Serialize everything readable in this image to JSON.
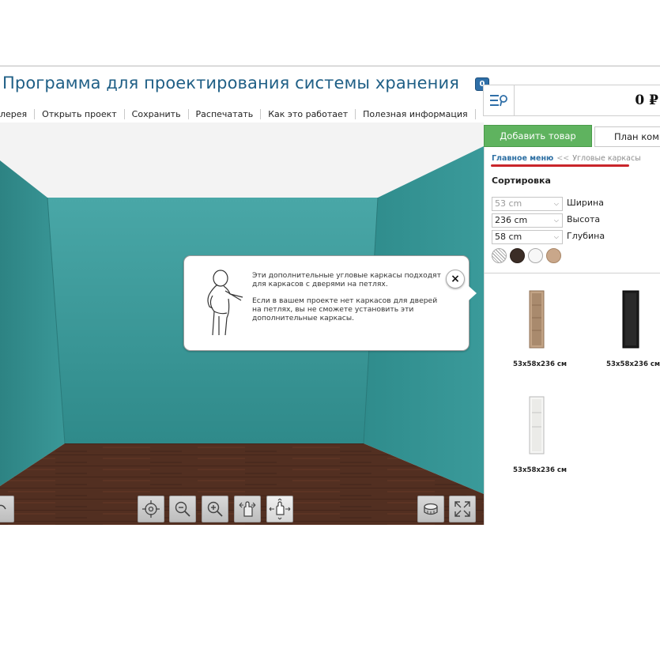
{
  "header": {
    "title": "Программа для проектирования системы хранения"
  },
  "menu": {
    "items": [
      {
        "label": "лерея"
      },
      {
        "label": "Открыть проект"
      },
      {
        "label": "Сохранить"
      },
      {
        "label": "Распечатать"
      },
      {
        "label": "Как это работает"
      },
      {
        "label": "Полезная информация"
      }
    ]
  },
  "cart": {
    "count": "0",
    "icon": "cart-list-icon",
    "price": "0 ₽"
  },
  "tabs": {
    "add_product": "Добавить товар",
    "room_plan": "План комн"
  },
  "breadcrumb": {
    "main": "Главное меню",
    "separator": "<<",
    "current": "Угловые каркасы"
  },
  "sorting": {
    "title": "Сортировка",
    "width": {
      "value": "53 cm",
      "label": "Ширина",
      "disabled": true
    },
    "height": {
      "value": "236 cm",
      "label": "Высота"
    },
    "depth": {
      "value": "58 cm",
      "label": "Глубина"
    }
  },
  "color_swatches": [
    {
      "name": "striped-pattern",
      "color": "#d0d0d0"
    },
    {
      "name": "dark-brown",
      "color": "#3b2d26"
    },
    {
      "name": "white",
      "color": "#f7f7f7"
    },
    {
      "name": "oak",
      "color": "#c9a78a"
    }
  ],
  "products": [
    {
      "size": "53x58x236 см",
      "color": "#b99b7d"
    },
    {
      "size": "53x58x236 см",
      "color": "#1c1c1c"
    },
    {
      "size": "53x58x236 см",
      "color": "#f4f4f2"
    }
  ],
  "callout": {
    "paragraph1": "Эти дополнительные угловые каркасы подходят для каркасов с дверями на петлях.",
    "paragraph2": "Если в вашем проекте нет каркасов для дверей на петлях, вы не сможете установить эти дополнительные каркасы.",
    "close_symbol": "×"
  },
  "viewport_tools": [
    {
      "icon": "center-view-icon"
    },
    {
      "icon": "zoom-out-icon"
    },
    {
      "icon": "zoom-in-icon"
    },
    {
      "icon": "rotate-hand-icon"
    },
    {
      "icon": "pan-hand-icon"
    }
  ],
  "colors": {
    "wall": "#3f9d9d",
    "floor": "#5c3426",
    "accent_green": "#5fb35f",
    "title_blue": "#1f5f86",
    "underline_red": "#c9252b"
  }
}
